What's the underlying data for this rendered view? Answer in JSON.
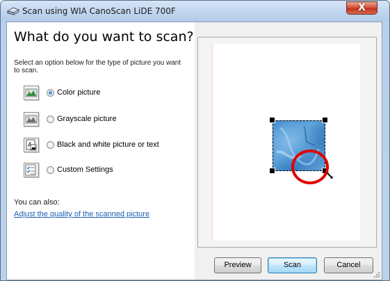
{
  "window": {
    "title": "Scan using WIA CanoScan LiDE 700F",
    "close_symbol": "X"
  },
  "left": {
    "heading": "What do you want to scan?",
    "instruction": "Select an option below for the type of picture you want to scan.",
    "options": [
      {
        "label": "Color picture",
        "selected": true,
        "icon": "color-picture-icon"
      },
      {
        "label": "Grayscale picture",
        "selected": false,
        "icon": "grayscale-picture-icon"
      },
      {
        "label": "Black and white picture or text",
        "selected": false,
        "icon": "black-white-picture-icon"
      },
      {
        "label": "Custom Settings",
        "selected": false,
        "icon": "custom-settings-icon"
      }
    ],
    "also_label": "You can also:",
    "quality_link": "Adjust the quality of the scanned picture"
  },
  "buttons": {
    "preview": "Preview",
    "scan": "Scan",
    "cancel": "Cancel"
  },
  "colors": {
    "link": "#1a5fb4",
    "highlight_circle": "#e00000",
    "scan_preview_blue": "#3f86c9"
  }
}
